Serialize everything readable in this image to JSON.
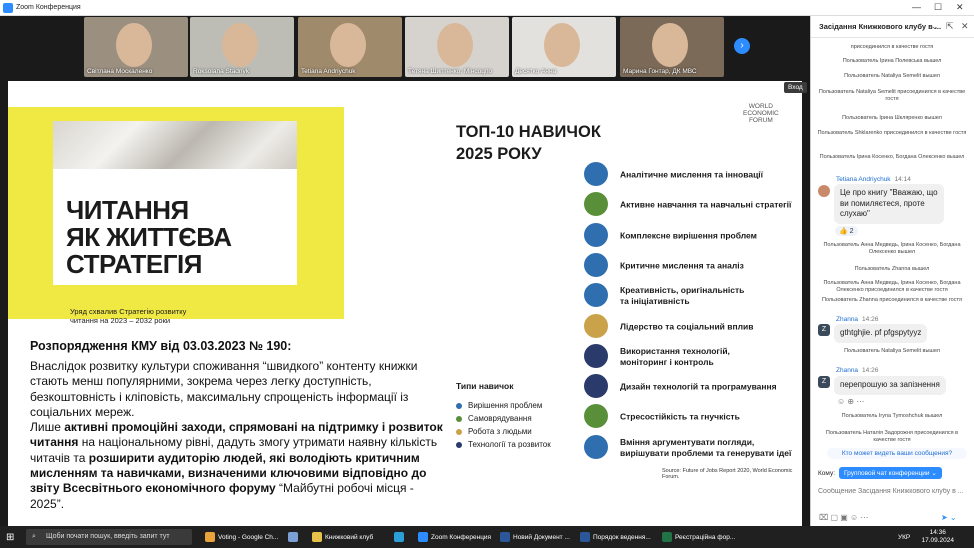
{
  "window": {
    "title": "Zoom Конференция"
  },
  "participants": [
    {
      "name": "Світлана Москаленко",
      "bg": "#9b8f80"
    },
    {
      "name": "Roksolana Stadnyk",
      "bg": "#bdbdb6"
    },
    {
      "name": "Tetiana Andriychuk",
      "bg": "#a08a6c"
    },
    {
      "name": "Тетяна Шиптенко, Мінсоцпо",
      "bg": "#d6d3cf"
    },
    {
      "name": "Десятко Анна",
      "bg": "#e3e1de"
    },
    {
      "name": "Марина Гонтар, ДК МВС",
      "bg": "#7c6a58"
    }
  ],
  "share": {
    "vhod_label": "Вход"
  },
  "slide": {
    "title_lines": [
      "ЧИТАННЯ",
      "ЯК ЖИТТЄВА",
      "СТРАТЕГІЯ"
    ],
    "subtitle": "Уряд схвалив Стратегію розвитку\nчитання на 2023 – 2032 роки",
    "order": "Розпорядження КМУ від 03.03.2023 № 190:",
    "para1": "Внаслідок розвитку культури споживання “швидкого” контенту книжки стають менш популярними, зокрема через легку доступність, безкоштовність і кліповість, максимальну спрощеність інформації із соціальних мереж.",
    "p2_1": "Лише ",
    "p2_2": "активні промоційні заходи, спрямовані на підтримку і розвиток читання",
    "p2_3": " на національному рівні, дадуть змогу утримати наявну кількість читачів та ",
    "p2_4": "розширити аудиторію людей, які володіють критичним мисленням та навичками, визначеними ключовими відповідно до звіту Всесвітнього економічного форуму",
    "p2_5": " “Майбутні робочі місця - 2025”.",
    "top10": "ТОП-10 НАВИЧОК\n2025 РОКУ",
    "wef": "WORLD\nECONOMIC\nFORUM",
    "skills": [
      {
        "label": "Аналітичне мислення та інновації",
        "color": "#2f6fb0"
      },
      {
        "label": "Активне навчання та навчальні стратегії",
        "color": "#5a8f3a"
      },
      {
        "label": "Комплексне вирішення проблем",
        "color": "#2f6fb0"
      },
      {
        "label": "Критичне мислення та аналіз",
        "color": "#2f6fb0"
      },
      {
        "label": "Креативність, оригінальність\nта ініціативність",
        "color": "#2f6fb0"
      },
      {
        "label": "Лідерство та соціальний вплив",
        "color": "#c9a24a"
      },
      {
        "label": "Використання технологій,\nмоніторинг і контроль",
        "color": "#2a3a6a"
      },
      {
        "label": "Дизайн технологій та програмування",
        "color": "#2a3a6a"
      },
      {
        "label": "Стресостійкість та гнучкість",
        "color": "#5a8f3a"
      },
      {
        "label": "Вміння аргументувати погляди,\nвирішувати проблеми та генерувати ідеї",
        "color": "#2f6fb0"
      }
    ],
    "legend_title": "Типи навичок",
    "legend": [
      {
        "label": "Вирішення проблем",
        "color": "#2f6fb0"
      },
      {
        "label": "Самоврядування",
        "color": "#5a8f3a"
      },
      {
        "label": "Робота з людьми",
        "color": "#c9a24a"
      },
      {
        "label": "Технології та розвиток",
        "color": "#2a3a6a"
      }
    ],
    "source": "Source: Future of Jobs Report 2020, World Economic Forum."
  },
  "chat": {
    "title": "Засідання Книжкового клубу в ...",
    "sys_top": [
      "присоединился в качестве гостя",
      "Пользователь Ірина Полевська вышел",
      "Пользователь Nataliya Semelit вышел",
      "Пользователь Nataliya Semelit присоединился в качестве гостя",
      "Пользователь Ірина Шкляренко вышел",
      "Пользователь Shklarenko присоединился в качестве гостя",
      "Пользователь Ірина Косенко, Богдана Олексенко вышел"
    ],
    "msg1_sender": "Tetiana Andriychuk",
    "msg1_time": "14:14",
    "msg1_text": "Це про книгу \"Вважаю, що ви помиляєтеся, проте слухаю\"",
    "msg1_react": "👍 2",
    "sys_mid": [
      "Пользователь Анна Медведь, Ірина Косенко, Богдана Олексенко вышел",
      "Пользователь Zhanna вышел",
      "Пользователь Анна Медведь, Ірина Косенко, Богдана Олексенко присоединился в качестве гостя",
      "Пользователь Zhanna присоединился в качестве гостя"
    ],
    "msg2_sender": "Zhanna",
    "msg2_time": "14:26",
    "msg2_text": "gthtghjie. pf pfgspytyyz",
    "sys_mid2": [
      "Пользователь Nataliya Semelit вышел"
    ],
    "msg3_sender": "Zhanna",
    "msg3_time": "14:26",
    "msg3_text": "перепрошую за запізнення",
    "sys_bot": [
      "Пользователь Iryna Tymoshchuk вышел",
      "Пользователь Наталія Задорожня присоединился в качестве гостя"
    ],
    "new_msgs": "Кто может видеть ваши сообщения?",
    "to_label": "Кому:",
    "group_label": "Групповой чат конференции ⌄",
    "input_placeholder": "Сообщение Засідання Книжкового клубу в ..."
  },
  "taskbar": {
    "search_placeholder": "Щоби почати пошук, введіть запит тут",
    "apps": [
      {
        "label": "Voting - Google Ch...",
        "color": "#e8a33a"
      },
      {
        "label": "",
        "color": "#7aa0d6"
      },
      {
        "label": "Книжковий клуб",
        "color": "#e6c24a"
      },
      {
        "label": "",
        "color": "#2a9fd8"
      },
      {
        "label": "Zoom Конференция",
        "color": "#2d8cff"
      },
      {
        "label": "Новий Документ ...",
        "color": "#2b579a"
      },
      {
        "label": "Порядок ведення...",
        "color": "#2b579a"
      },
      {
        "label": "Реєстраційна фор...",
        "color": "#217346"
      }
    ],
    "lang": "УКР",
    "time": "14:36",
    "date": "17.09.2024"
  }
}
